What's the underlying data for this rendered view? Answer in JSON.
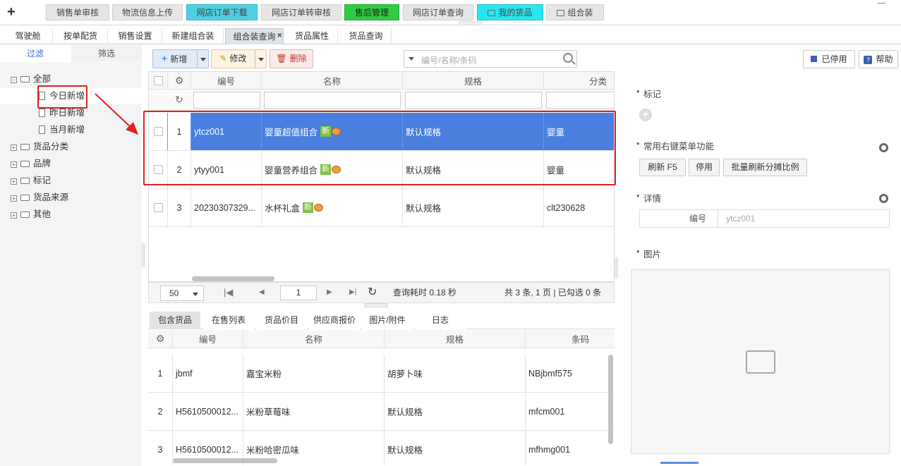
{
  "top_tabs": [
    {
      "label": "销售单审核",
      "color": "#e6e6e6"
    },
    {
      "label": "物流信息上传",
      "color": "#e6e6e6"
    },
    {
      "label": "网店订单下载",
      "color": "#4dd0e1"
    },
    {
      "label": "网店订单转审核",
      "color": "#e6e6e6"
    },
    {
      "label": "售后管理",
      "color": "#2ecc40"
    },
    {
      "label": "网店订单查询",
      "color": "#e6e6e6"
    },
    {
      "label": "我的货品",
      "color": "#27e6f0"
    },
    {
      "label": "组合装",
      "color": "#e6e6e6"
    }
  ],
  "sub_tabs": [
    "驾驶舱",
    "按单配货",
    "销售设置",
    "新建组合装",
    "组合装查询",
    "货品属性",
    "货品查询"
  ],
  "left_panel": {
    "tab_filter": "过滤",
    "tab_screen": "筛选",
    "tree_all": "全部",
    "tree_today": "今日新增",
    "tree_yesterday": "昨日新增",
    "tree_month": "当月新增",
    "tree_category": "货品分类",
    "tree_brand": "品牌",
    "tree_mark": "标记",
    "tree_source": "货品来源",
    "tree_other": "其他"
  },
  "toolbar": {
    "new": "新增",
    "edit": "修改",
    "delete": "删除",
    "search_placeholder": "编号/名称/条码",
    "disabled": "已停用",
    "help": "帮助"
  },
  "grid": {
    "headers": {
      "code": "编号",
      "name": "名称",
      "spec": "规格",
      "category": "分类"
    },
    "rows": [
      {
        "num": "1",
        "code": "ytcz001",
        "name": "婴童超值组合",
        "badge": "新",
        "spec": "默认规格",
        "category": "婴童"
      },
      {
        "num": "2",
        "code": "ytyy001",
        "name": "婴童营养组合",
        "badge": "新",
        "spec": "默认规格",
        "category": "婴童"
      },
      {
        "num": "3",
        "code": "20230307329...",
        "name": "水杯礼盒",
        "badge": "新",
        "spec": "默认规格",
        "category": "clt230628"
      }
    ]
  },
  "pager": {
    "page_size": "50",
    "page": "1",
    "elapsed": "查询耗时 0.18 秒",
    "summary": "共 3 条, 1 页 | 已勾选 0 条"
  },
  "bottom_tabs": [
    "包含货品",
    "在售列表",
    "货品价目",
    "供应商报价",
    "图片/附件",
    "日志"
  ],
  "grid2": {
    "headers": {
      "code": "编号",
      "name": "名称",
      "spec": "规格",
      "barcode": "条码"
    },
    "rows": [
      {
        "num": "1",
        "code": "jbmf",
        "name": "嘉宝米粉",
        "spec": "胡萝卜味",
        "barcode": "NBjbmf575"
      },
      {
        "num": "2",
        "code": "H5610500012...",
        "name": "米粉草莓味",
        "spec": "默认规格",
        "barcode": "mfcm001"
      },
      {
        "num": "3",
        "code": "H5610500012...",
        "name": "米粉哈密瓜味",
        "spec": "默认规格",
        "barcode": "mfhmg001"
      }
    ]
  },
  "right_panel": {
    "mark_title": "标记",
    "menu_title": "常用右键菜单功能",
    "refresh": "刷新 F5",
    "stop": "停用",
    "batch": "批量刷新分摊比例",
    "detail_title": "详情",
    "detail_key": "编号",
    "detail_value": "ytcz001",
    "image_title": "图片"
  }
}
